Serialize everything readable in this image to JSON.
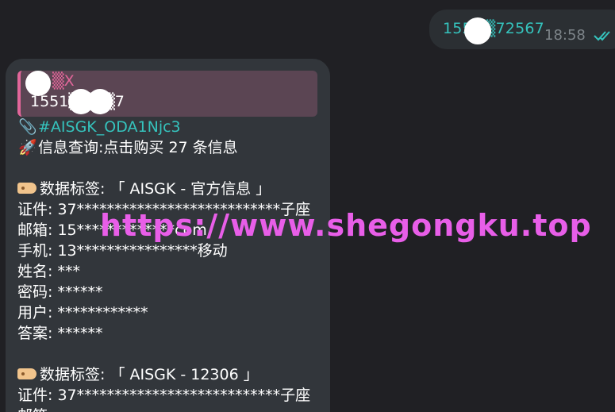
{
  "outgoing": {
    "text": "155▒▒72567",
    "time": "18:58",
    "status": "read-double-check",
    "colors": {
      "text": "#35c3bd",
      "bubble": "#2b2f33"
    }
  },
  "incoming": {
    "reply": {
      "name": "▒X",
      "text": "1551▒▒▒▒7"
    },
    "lines": [
      {
        "icon": "paperclip-icon",
        "emoji": "📎",
        "text": "#AISGK_ODA1Njc3",
        "hashtag": true
      },
      {
        "icon": "rocket-icon",
        "emoji": "🚀",
        "text": "信息查询:点击购买 27 条信息"
      },
      {
        "blank": true
      },
      {
        "icon": "tag-icon",
        "text": "数据标签: 「 AISGK - 官方信息 」"
      },
      {
        "text": "证件: 37***************************子座"
      },
      {
        "text": "邮箱: 15*************com"
      },
      {
        "text": "手机: 13****************移动"
      },
      {
        "text": "姓名: ***"
      },
      {
        "text": "密码: ******"
      },
      {
        "text": "用户: ************"
      },
      {
        "text": "答案: ******"
      },
      {
        "blank": true
      },
      {
        "icon": "tag-icon",
        "text": "数据标签: 「 AISGK - 12306 」"
      },
      {
        "text": "证件: 37***************************子座"
      },
      {
        "text": "邮箱:"
      }
    ]
  },
  "watermark": "https://www.shegongku.top"
}
